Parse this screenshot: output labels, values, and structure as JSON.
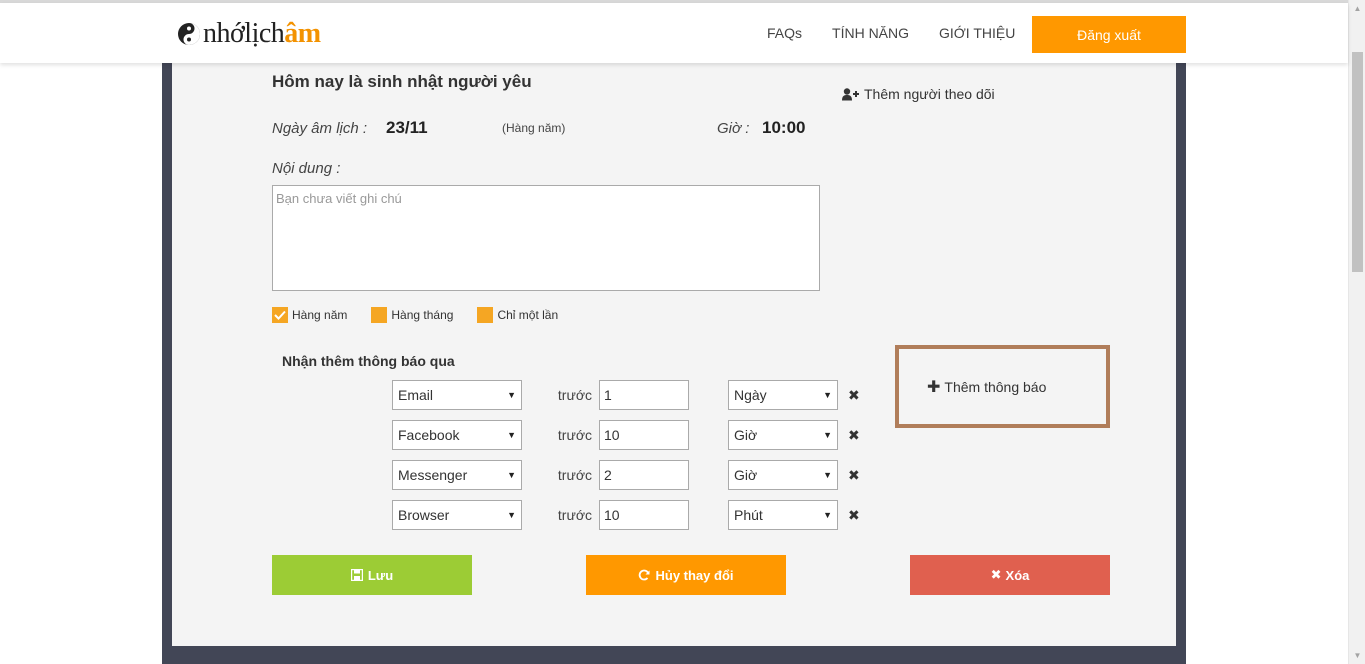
{
  "header": {
    "logo_part1": "nhớlịch",
    "logo_part2": "âm",
    "nav": [
      "FAQs",
      "TÍNH NĂNG",
      "GIỚI THIỆU"
    ],
    "logout_label": "Đăng xuất"
  },
  "event": {
    "title": "Hôm nay là sinh nhật người yêu",
    "follow_label": "Thêm người theo dõi",
    "lunar_label": "Ngày âm lịch :",
    "lunar_value": "23/11",
    "repeat_note": "(Hàng năm)",
    "hour_label": "Giờ :",
    "hour_value": "10:00",
    "content_label": "Nội dung :",
    "content_placeholder": "Bạn chưa viết ghi chú",
    "content_value": ""
  },
  "repeat_options": [
    {
      "label": "Hàng năm",
      "checked": true
    },
    {
      "label": "Hàng tháng",
      "checked": false
    },
    {
      "label": "Chỉ một lần",
      "checked": false
    }
  ],
  "notify": {
    "title": "Nhận thêm thông báo qua",
    "before_label": "trước",
    "add_label": "Thêm thông báo",
    "rows": [
      {
        "channel": "Email",
        "amount": "1",
        "unit": "Ngày"
      },
      {
        "channel": "Facebook",
        "amount": "10",
        "unit": "Giờ"
      },
      {
        "channel": "Messenger",
        "amount": "2",
        "unit": "Giờ"
      },
      {
        "channel": "Browser",
        "amount": "10",
        "unit": "Phút"
      }
    ]
  },
  "actions": {
    "save_label": "Lưu",
    "cancel_label": "Hủy thay đổi",
    "delete_label": "Xóa"
  },
  "colors": {
    "accent": "#ff9800",
    "save": "#9ccc35",
    "delete": "#e0604f",
    "frame": "#424656"
  }
}
